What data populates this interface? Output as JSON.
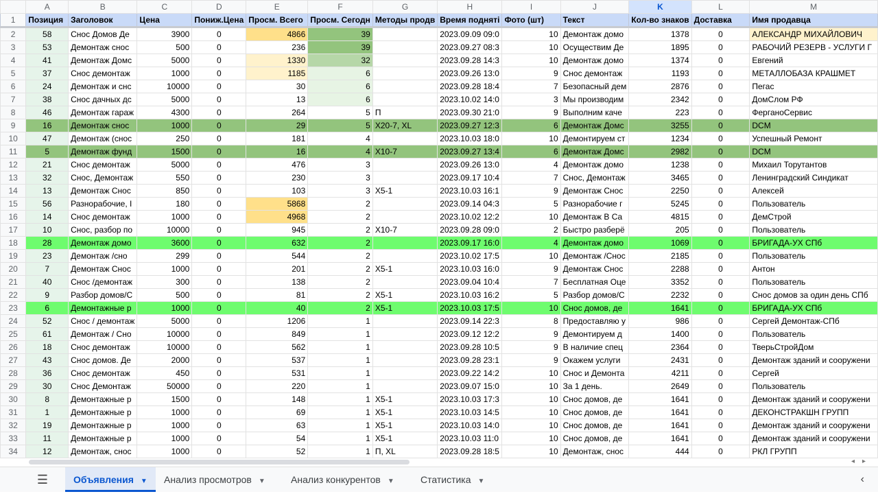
{
  "columns": [
    "A",
    "B",
    "C",
    "D",
    "E",
    "F",
    "G",
    "H",
    "I",
    "J",
    "K",
    "L",
    "M"
  ],
  "selected_column": "K",
  "header_row": [
    "Позиция",
    "Заголовок",
    "Цена",
    "Пониж.Цена",
    "Просм. Всего",
    "Просм. Сегодн",
    "Методы продв",
    "Время подняті",
    "Фото (шт)",
    "Текст",
    "Кол-во знаков",
    "Доставка",
    "Имя продавца"
  ],
  "rows": [
    {
      "n": "2",
      "c": [
        "58",
        "Снос Домов Де",
        "3900",
        "0",
        "4866",
        "39",
        "",
        "2023.09.09 09:0",
        "10",
        "Демонтаж домо",
        "1378",
        "0",
        "АЛЕКСАНДР МИХАЙЛОВИЧ"
      ]
    },
    {
      "n": "3",
      "c": [
        "53",
        "Демонтаж снос",
        "500",
        "0",
        "236",
        "39",
        "",
        "2023.09.27 08:3",
        "10",
        "Осуществим Де",
        "1895",
        "0",
        "РАБОЧИЙ РЕЗЕРВ - УСЛУГИ Г"
      ]
    },
    {
      "n": "4",
      "c": [
        "41",
        "Демонтаж Домс",
        "5000",
        "0",
        "1330",
        "32",
        "",
        "2023.09.28 14:3",
        "10",
        "Демонтаж домо",
        "1374",
        "0",
        "Евгений"
      ]
    },
    {
      "n": "5",
      "c": [
        "37",
        "Снос демонтаж",
        "1000",
        "0",
        "1185",
        "6",
        "",
        "2023.09.26 13:0",
        "9",
        "Снос демонтаж",
        "1193",
        "0",
        "МЕТАЛЛОБАЗА КРАШМЕТ"
      ]
    },
    {
      "n": "6",
      "c": [
        "24",
        "Демонтаж и снс",
        "10000",
        "0",
        "30",
        "6",
        "",
        "2023.09.28 18:4",
        "7",
        "Безопасный дем",
        "2876",
        "0",
        "Пегас"
      ]
    },
    {
      "n": "7",
      "c": [
        "38",
        "Снос дачных дс",
        "5000",
        "0",
        "13",
        "6",
        "",
        "2023.10.02 14:0",
        "3",
        "Мы производим",
        "2342",
        "0",
        "ДомСлом РФ"
      ]
    },
    {
      "n": "8",
      "c": [
        "46",
        "Демонтаж гараж",
        "4300",
        "0",
        "264",
        "5",
        "П",
        "2023.09.30 21:0",
        "9",
        "Выполним каче",
        "223",
        "0",
        "ФерганоСервис"
      ]
    },
    {
      "n": "9",
      "c": [
        "16",
        "Демонтаж снос",
        "1000",
        "0",
        "29",
        "5",
        "X20-7, XL",
        "2023.09.27 12:3",
        "6",
        "Демонтаж Домс",
        "3255",
        "0",
        "DCM"
      ]
    },
    {
      "n": "10",
      "c": [
        "47",
        "Демонтаж (снос",
        "250",
        "0",
        "181",
        "4",
        "",
        "2023.10.03 18:0",
        "10",
        "Демонтируем ст",
        "1234",
        "0",
        "Успешный Ремонт"
      ]
    },
    {
      "n": "11",
      "c": [
        "5",
        "Демонтаж фунд",
        "1500",
        "0",
        "16",
        "4",
        "X10-7",
        "2023.09.27 13:4",
        "6",
        "Демонтаж Домс",
        "2982",
        "0",
        "DCM"
      ]
    },
    {
      "n": "12",
      "c": [
        "21",
        "Снос демонтаж",
        "5000",
        "0",
        "476",
        "3",
        "",
        "2023.09.26 13:0",
        "4",
        "Демонтаж домо",
        "1238",
        "0",
        "Михаил Торутантов"
      ]
    },
    {
      "n": "13",
      "c": [
        "32",
        "Снос, Демонтаж",
        "550",
        "0",
        "230",
        "3",
        "",
        "2023.09.17 10:4",
        "7",
        "Снос, Демонтаж",
        "3465",
        "0",
        "Ленинградский Синдикат"
      ]
    },
    {
      "n": "14",
      "c": [
        "13",
        "Демонтаж Снос",
        "850",
        "0",
        "103",
        "3",
        "X5-1",
        "2023.10.03 16:1",
        "9",
        "Демонтаж Снос",
        "2250",
        "0",
        "Алексей"
      ]
    },
    {
      "n": "15",
      "c": [
        "56",
        "Разнорабочие, I",
        "180",
        "0",
        "5868",
        "2",
        "",
        "2023.09.14 04:3",
        "5",
        "Разнорабочие г",
        "5245",
        "0",
        "Пользователь"
      ]
    },
    {
      "n": "16",
      "c": [
        "14",
        "Снос демонтаж",
        "1000",
        "0",
        "4968",
        "2",
        "",
        "2023.10.02 12:2",
        "10",
        "Демонтаж В Са",
        "4815",
        "0",
        "ДемСтрой"
      ]
    },
    {
      "n": "17",
      "c": [
        "10",
        "Снос, разбор по",
        "10000",
        "0",
        "945",
        "2",
        "X10-7",
        "2023.09.28 09:0",
        "2",
        "Быстро разберё",
        "205",
        "0",
        "Пользователь"
      ]
    },
    {
      "n": "18",
      "c": [
        "28",
        "Демонтаж домо",
        "3600",
        "0",
        "632",
        "2",
        "",
        "2023.09.17 16:0",
        "4",
        "Демонтаж домо",
        "1069",
        "0",
        "БРИГАДА-УХ СПб"
      ]
    },
    {
      "n": "19",
      "c": [
        "23",
        "Демонтаж /сно",
        "299",
        "0",
        "544",
        "2",
        "",
        "2023.10.02 17:5",
        "10",
        "Демонтаж /Снос",
        "2185",
        "0",
        "Пользователь"
      ]
    },
    {
      "n": "20",
      "c": [
        "7",
        "Демонтаж Снос",
        "1000",
        "0",
        "201",
        "2",
        "X5-1",
        "2023.10.03 16:0",
        "9",
        "Демонтаж Снос",
        "2288",
        "0",
        "Антон"
      ]
    },
    {
      "n": "21",
      "c": [
        "40",
        "Снос /демонтаж",
        "300",
        "0",
        "138",
        "2",
        "",
        "2023.09.04 10:4",
        "7",
        "Бесплатная Оце",
        "3352",
        "0",
        "Пользователь"
      ]
    },
    {
      "n": "22",
      "c": [
        "9",
        "Разбор домов/С",
        "500",
        "0",
        "81",
        "2",
        "X5-1",
        "2023.10.03 16:2",
        "5",
        "Разбор домов/С",
        "2232",
        "0",
        "Снос домов за один день СПб"
      ]
    },
    {
      "n": "23",
      "c": [
        "6",
        "Демонтажные р",
        "1000",
        "0",
        "40",
        "2",
        "X5-1",
        "2023.10.03 17:5",
        "10",
        "Снос домов, де",
        "1641",
        "0",
        "БРИГАДА-УХ СПб"
      ]
    },
    {
      "n": "24",
      "c": [
        "52",
        "Снос / демонтаж",
        "5000",
        "0",
        "1206",
        "1",
        "",
        "2023.09.14 22:3",
        "8",
        "Предоставляю у",
        "986",
        "0",
        "Сергей Демонтаж-СПб"
      ]
    },
    {
      "n": "25",
      "c": [
        "61",
        "Демонтаж / Сно",
        "10000",
        "0",
        "849",
        "1",
        "",
        "2023.09.12 12:2",
        "9",
        "Демонтируем д",
        "1400",
        "0",
        "Пользователь"
      ]
    },
    {
      "n": "26",
      "c": [
        "18",
        "Снос демонтаж",
        "10000",
        "0",
        "562",
        "1",
        "",
        "2023.09.28 10:5",
        "9",
        "В наличие спец",
        "2364",
        "0",
        "ТверьСтройДом"
      ]
    },
    {
      "n": "27",
      "c": [
        "43",
        "Снос домов. Де",
        "2000",
        "0",
        "537",
        "1",
        "",
        "2023.09.28 23:1",
        "9",
        "Окажем услуги",
        "2431",
        "0",
        "Демонтаж зданий и сооружени"
      ]
    },
    {
      "n": "28",
      "c": [
        "36",
        "Снос демонтаж",
        "450",
        "0",
        "531",
        "1",
        "",
        "2023.09.22 14:2",
        "10",
        "Снос и Демонта",
        "4211",
        "0",
        "Сергей"
      ]
    },
    {
      "n": "29",
      "c": [
        "30",
        "Снос Демонтаж",
        "50000",
        "0",
        "220",
        "1",
        "",
        "2023.09.07 15:0",
        "10",
        "За 1 день.",
        "2649",
        "0",
        "Пользователь"
      ]
    },
    {
      "n": "30",
      "c": [
        "8",
        "Демонтажные р",
        "1500",
        "0",
        "148",
        "1",
        "X5-1",
        "2023.10.03 17:3",
        "10",
        "Снос домов, де",
        "1641",
        "0",
        "Демонтаж зданий и сооружени"
      ]
    },
    {
      "n": "31",
      "c": [
        "1",
        "Демонтажные р",
        "1000",
        "0",
        "69",
        "1",
        "X5-1",
        "2023.10.03 14:5",
        "10",
        "Снос домов, де",
        "1641",
        "0",
        "ДЕКОНСТРАКШН ГРУПП"
      ]
    },
    {
      "n": "32",
      "c": [
        "19",
        "Демонтажные р",
        "1000",
        "0",
        "63",
        "1",
        "X5-1",
        "2023.10.03 14:0",
        "10",
        "Снос домов, де",
        "1641",
        "0",
        "Демонтаж зданий и сооружени"
      ]
    },
    {
      "n": "33",
      "c": [
        "11",
        "Демонтажные р",
        "1000",
        "0",
        "54",
        "1",
        "X5-1",
        "2023.10.03 11:0",
        "10",
        "Снос домов, де",
        "1641",
        "0",
        "Демонтаж зданий и сооружени"
      ]
    },
    {
      "n": "34",
      "c": [
        "12",
        "Демонтаж, снос",
        "1000",
        "0",
        "52",
        "1",
        "П, XL",
        "2023.09.28 18:5",
        "10",
        "Демонтаж, снос",
        "444",
        "0",
        "РКЛ ГРУПП"
      ]
    }
  ],
  "row_highlights": {
    "9": "g1",
    "11": "g1",
    "18": "g2",
    "23": "g2"
  },
  "cell_colors": {
    "2-E": "#ffe08a",
    "3-F": "#93c47d",
    "2-F": "#93c47d",
    "4-F": "#b6d7a8",
    "4-E": "#fff2cc",
    "5-E": "#fff2cc",
    "5-F": "#e7f4e4",
    "6-F": "#e7f4e4",
    "7-F": "#e7f4e4",
    "15-E": "#ffe08a",
    "16-E": "#ffe08a",
    "2-M": "#fff2cc"
  },
  "tabs": [
    {
      "label": "Объявления",
      "active": true
    },
    {
      "label": "Анализ просмотров",
      "active": false
    },
    {
      "label": "Анализ конкурентов",
      "active": false
    },
    {
      "label": "Статистика",
      "active": false
    }
  ],
  "icons": {
    "menu": "hamburger-icon",
    "tab_caret": "caret-down-icon",
    "scroll_left": "chevron-left-icon"
  }
}
